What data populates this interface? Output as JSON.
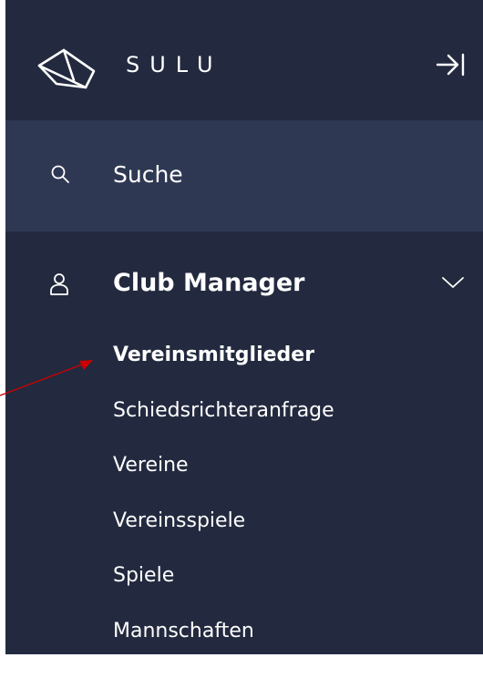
{
  "app": {
    "title": "SULU"
  },
  "search": {
    "label": "Suche"
  },
  "navigation": {
    "group_label": "Club Manager",
    "items": [
      {
        "label": "Vereinsmitglieder",
        "active": true
      },
      {
        "label": "Schiedsrichteranfrage",
        "active": false
      },
      {
        "label": "Vereine",
        "active": false
      },
      {
        "label": "Vereinsspiele",
        "active": false
      },
      {
        "label": "Spiele",
        "active": false
      },
      {
        "label": "Mannschaften",
        "active": false
      }
    ]
  },
  "icons": {
    "logo": "sulu-logo-icon",
    "collapse": "collapse-sidebar-icon",
    "search": "search-icon",
    "user": "user-icon",
    "chevron": "chevron-down-icon"
  },
  "colors": {
    "sidebar_bg": "#232a3f",
    "search_bg": "#2f3853",
    "text": "#ffffff",
    "annotation_arrow": "#cc0000"
  }
}
